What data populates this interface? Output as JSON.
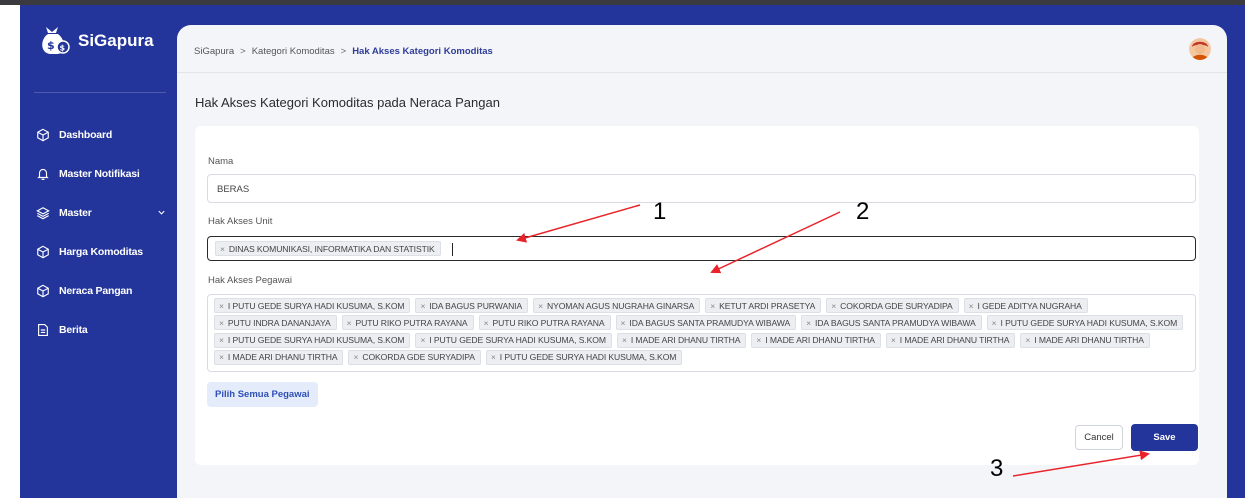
{
  "app": {
    "name": "SiGapura"
  },
  "sidebar": {
    "items": [
      {
        "label": "Dashboard",
        "icon": "cube-icon"
      },
      {
        "label": "Master Notifikasi",
        "icon": "bell-icon"
      },
      {
        "label": "Master",
        "icon": "layers-icon",
        "has_submenu": true
      },
      {
        "label": "Harga Komoditas",
        "icon": "cube-icon"
      },
      {
        "label": "Neraca Pangan",
        "icon": "cube-icon"
      },
      {
        "label": "Berita",
        "icon": "document-icon"
      }
    ]
  },
  "breadcrumb": {
    "items": [
      "SiGapura",
      "Kategori Komoditas"
    ],
    "current": "Hak Akses Kategori Komoditas",
    "separator": ">"
  },
  "page": {
    "title": "Hak Akses Kategori Komoditas pada Neraca Pangan"
  },
  "form": {
    "nama": {
      "label": "Nama",
      "value": "BERAS"
    },
    "unit": {
      "label": "Hak Akses Unit",
      "tags": [
        "DINAS KOMUNIKASI, INFORMATIKA DAN STATISTIK"
      ]
    },
    "pegawai": {
      "label": "Hak Akses Pegawai",
      "tags": [
        "I PUTU GEDE SURYA HADI KUSUMA, S.KOM",
        "IDA BAGUS PURWANIA",
        "NYOMAN AGUS NUGRAHA GINARSA",
        "KETUT ARDI PRASETYA",
        "COKORDA GDE SURYADIPA",
        "I GEDE ADITYA NUGRAHA",
        "PUTU INDRA DANANJAYA",
        "PUTU RIKO PUTRA RAYANA",
        "PUTU RIKO PUTRA RAYANA",
        "IDA BAGUS SANTA PRAMUDYA WIBAWA",
        "IDA BAGUS SANTA PRAMUDYA WIBAWA",
        "I PUTU GEDE SURYA HADI KUSUMA, S.KOM",
        "I PUTU GEDE SURYA HADI KUSUMA, S.KOM",
        "I PUTU GEDE SURYA HADI KUSUMA, S.KOM",
        "I MADE ARI DHANU TIRTHA",
        "I MADE ARI DHANU TIRTHA",
        "I MADE ARI DHANU TIRTHA",
        "I MADE ARI DHANU TIRTHA",
        "I MADE ARI DHANU TIRTHA",
        "COKORDA GDE SURYADIPA",
        "I PUTU GEDE SURYA HADI KUSUMA, S.KOM"
      ]
    },
    "pilih_semua_label": "Pilih Semua Pegawai",
    "cancel_label": "Cancel",
    "save_label": "Save"
  },
  "annotations": [
    "1",
    "2",
    "3"
  ],
  "colors": {
    "primary": "#23349a",
    "annotation_arrow": "#e8242a"
  }
}
